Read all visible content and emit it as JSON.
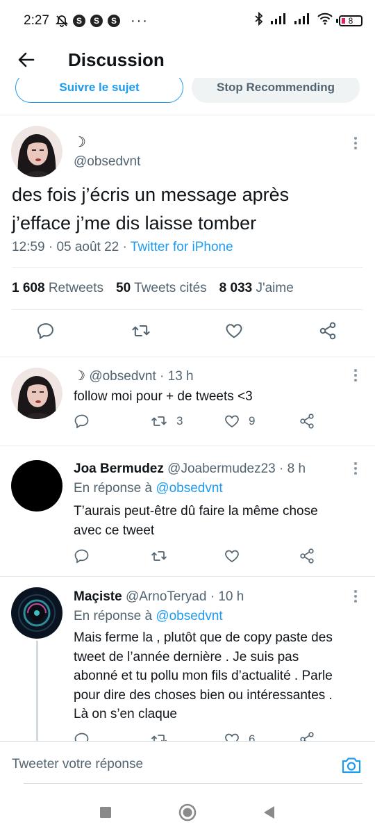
{
  "status_bar": {
    "time": "2:27",
    "dots": "···",
    "battery": "8",
    "app_icons": [
      "S",
      "S",
      "S"
    ]
  },
  "header": {
    "title": "Discussion"
  },
  "topic_buttons": {
    "follow_label": "Suivre le sujet",
    "stop_label": "Stop Recommending"
  },
  "main_tweet": {
    "name": "☽",
    "handle": "@obsedvnt",
    "text_line1": "des fois j’écris un message après",
    "text_line2": "j’efface j’me dis laisse tomber",
    "time": "12:59",
    "date": "05 août 22",
    "source": "Twitter for iPhone",
    "retweets_count": "1 608",
    "retweets_label": "Retweets",
    "quotes_count": "50",
    "quotes_label": "Tweets cités",
    "likes_count": "8 033",
    "likes_label": "J'aime"
  },
  "replies": [
    {
      "name": "☽",
      "handle": "@obsedvnt",
      "time": "13 h",
      "reply_to_prefix": "",
      "reply_to": "",
      "text": "follow moi pour + de tweets <3",
      "replies": "",
      "retweets": "3",
      "likes": "9"
    },
    {
      "name": "Joa Bermudez",
      "handle": "@Joabermudez23",
      "time": "8 h",
      "reply_to_prefix": "En réponse à",
      "reply_to": "@obsedvnt",
      "text_line1": "T’aurais peut-être dû faire la même chose",
      "text_line2": "avec ce tweet",
      "replies": "",
      "retweets": "",
      "likes": ""
    },
    {
      "name": "Maçiste",
      "handle": "@ArnoTeryad",
      "time": "10 h",
      "reply_to_prefix": "En réponse à",
      "reply_to": "@obsedvnt",
      "text_line1": "Mais ferme la , plutôt que de copy paste des",
      "text_line2": "tweet de l’année dernière .  Je suis pas",
      "text_line3": "abonné et tu pollu mon fils d’actualité . Parle",
      "text_line4": "pour dire des choses bien ou intéressantes .",
      "text_line5": "Là on s’en claque",
      "likes": "6"
    }
  ],
  "compose": {
    "placeholder": "Tweeter votre réponse"
  },
  "colors": {
    "accent": "#1d9bf0",
    "secondary_text": "#536471",
    "primary_text": "#0f1419",
    "divider": "#e6ecf0"
  }
}
